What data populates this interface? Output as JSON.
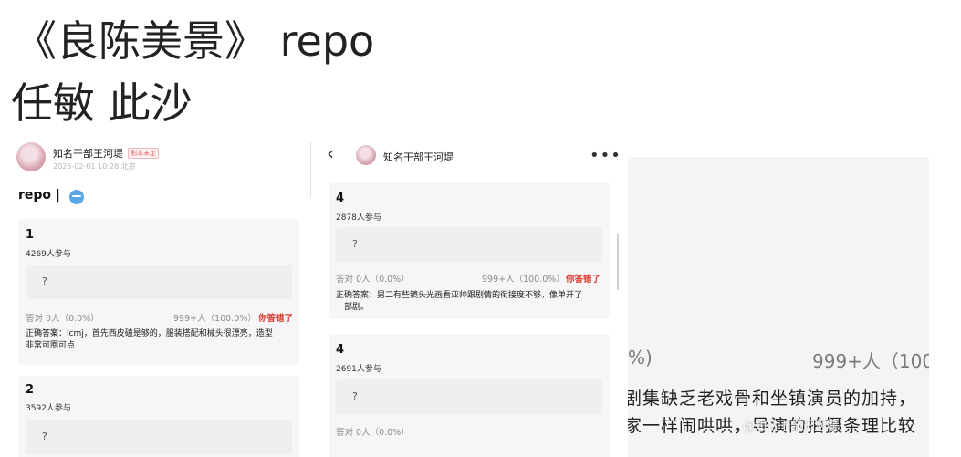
{
  "heading": {
    "line1": "《良陈美景》 repo",
    "line2": "任敏 此沙"
  },
  "panel1": {
    "user_name": "知名干部王河堤",
    "badge": "剧本未定",
    "meta": "2026-02-01 10:28  北京",
    "title": "repo |",
    "cards": [
      {
        "num": "1",
        "count": "4269人参与",
        "option": "?",
        "left_stat": "答对  0人（0.0%）",
        "right_stat": "999+人（100.0%）",
        "result": "你答错了",
        "answer_line1": "正确答案：lcmj，首先西皮磕是够的，服装搭配和械头很漂亮，造型",
        "answer_line2": "非常可圈可点"
      },
      {
        "num": "2",
        "count": "3592人参与",
        "option": "?"
      }
    ]
  },
  "panel2": {
    "user_name": "知名干部王河堤",
    "back_glyph": "‹",
    "more_glyph": "•••",
    "cards": [
      {
        "num": "4",
        "count": "2878人参与",
        "option": "?",
        "left_stat": "答对  0人（0.0%）",
        "right_stat": "999+人（100.0%）",
        "result": "你答错了",
        "answer_line1": "正确答案：男二有些镜头光画看亚帅跟剧情的衔接度不够，像单开了",
        "answer_line2": "一部剧。"
      },
      {
        "num": "4",
        "count": "2691人参与",
        "option": "?",
        "left_stat": "答对  0人（0.0%）"
      }
    ]
  },
  "panel3": {
    "stat_left": "%)",
    "stat_right": "999+人（100",
    "line1": "剧集缺乏老戏骨和坐镇演员的加持，",
    "line2": "家一样闹哄哄，导演的拍摄条理比较",
    "watermark": "@知名干部王河堤"
  },
  "colors": {
    "wrong": "#d9332b",
    "card_bg": "#f6f6f6"
  }
}
